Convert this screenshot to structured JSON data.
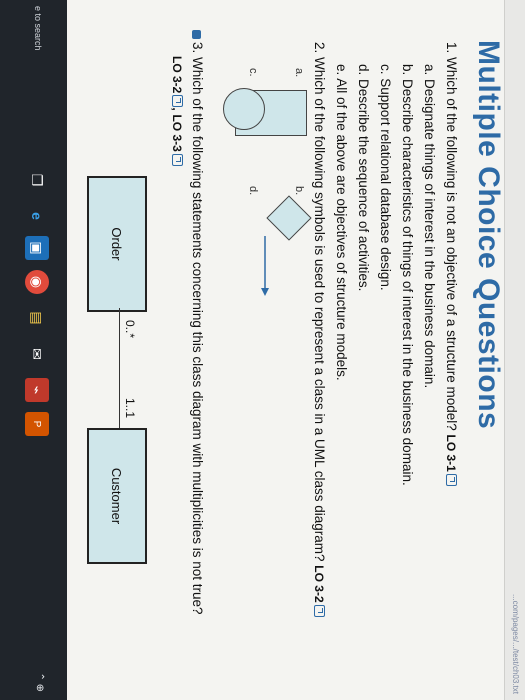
{
  "browser": {
    "url": "...com/pages/.../test/ch03.txt"
  },
  "page": {
    "title": "Multiple Choice Questions",
    "questions": [
      {
        "number": "1.",
        "text": "Which of the following is not an objective of a structure model?",
        "lo": "LO 3-1",
        "options": [
          "a. Designate things of interest in the business domain.",
          "b. Describe characteristics of things of interest in the business domain.",
          "c. Support relational database design.",
          "d. Describe the sequence of activities.",
          "e. All of the above are objectives of structure models."
        ]
      },
      {
        "number": "2.",
        "text": "Which of the following symbols is used to represent a class in a UML class diagram?",
        "lo": "LO 3-2",
        "symbol_labels": [
          "a.",
          "b.",
          "c.",
          "d."
        ]
      },
      {
        "number": "3.",
        "text": "Which of the following statements concerning this class diagram with multiplicities is not true?",
        "lo_a": "LO 3-2",
        "lo_sep": ",",
        "lo_b": "LO 3-3",
        "diagram": {
          "left_class": "Order",
          "right_class": "Customer",
          "left_mult": "0..*",
          "right_mult": "1..1"
        }
      }
    ]
  },
  "taskbar": {
    "search_placeholder": "e to search",
    "icons": [
      "task-view-icon",
      "edge-icon",
      "store-icon",
      "chrome-icon",
      "file-explorer-icon",
      "mail-icon",
      "pdf-icon",
      "powerpoint-icon"
    ],
    "tray": "⌃ ⊕"
  }
}
